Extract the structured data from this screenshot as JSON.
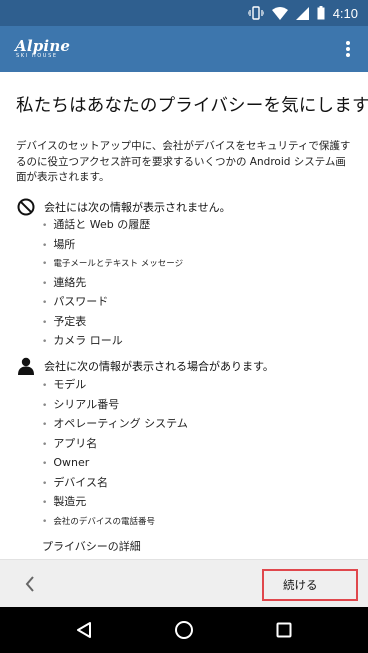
{
  "status_bar": {
    "time": "4:10",
    "icons": [
      "vibrate-icon",
      "wifi-icon",
      "signal-icon",
      "battery-icon"
    ]
  },
  "app_bar": {
    "logo_main": "Alpine",
    "logo_sub": "SKI HOUSE",
    "menu_icon": "more-vert-icon"
  },
  "content": {
    "title": "私たちはあなたのプライバシーを気にします。",
    "description": "デバイスのセットアップ中に、会社がデバイスをセキュリティで保護するのに役立つアクセス許可を要求するいくつかの Android システム画面が表示されます。",
    "not_visible": {
      "heading": "会社には次の情報が表示されません。",
      "icon": "prohibited-icon",
      "items": [
        "通話と Web の履歴",
        "場所",
        "電子メールとテキスト メッセージ",
        "連絡先",
        "パスワード",
        "予定表",
        "カメラ ロール"
      ]
    },
    "may_see": {
      "heading": "会社に次の情報が表示される場合があります。",
      "icon": "person-icon",
      "items": [
        "モデル",
        "シリアル番号",
        "オペレーティング システム",
        "アプリ名",
        "Owner",
        "デバイス名",
        "製造元",
        "会社のデバイスの電話番号"
      ]
    },
    "privacy_link": "プライバシーの詳細"
  },
  "bottom_bar": {
    "back_icon": "chevron-left-icon",
    "continue_label": "続ける"
  },
  "nav_bar": {
    "icons": [
      "back-triangle-icon",
      "home-circle-icon",
      "recents-square-icon"
    ]
  },
  "colors": {
    "status_bar": "#2f5f8f",
    "app_bar": "#3d76ad",
    "highlight_border": "#e0474c",
    "bottom_bar": "#efefef"
  }
}
